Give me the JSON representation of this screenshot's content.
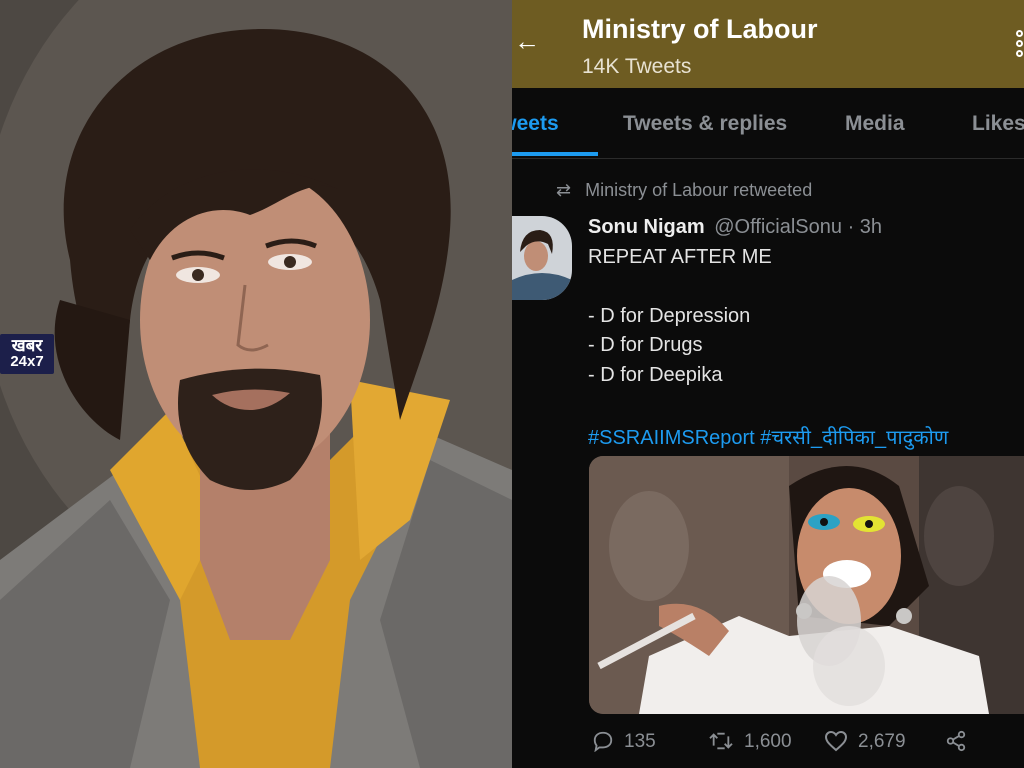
{
  "watermark": {
    "top": "खबर",
    "bottom": "24x7"
  },
  "profile": {
    "name": "Ministry of Labour",
    "tweet_count": "14K Tweets"
  },
  "tabs": [
    {
      "label": "Tweets",
      "active": true
    },
    {
      "label": "Tweets & replies",
      "active": false
    },
    {
      "label": "Media",
      "active": false
    },
    {
      "label": "Likes",
      "active": false
    }
  ],
  "tweet": {
    "retweet_label": "Ministry of Labour retweeted",
    "author_name": "Sonu Nigam",
    "author_handle": "@OfficialSonu",
    "time": "· 3h",
    "lines": [
      "REPEAT AFTER ME",
      "- D for Depression",
      "- D for Drugs",
      "- D for Deepika"
    ],
    "hashtags": "#SSRAIIMSReport #चरसी_दीपिका_पादुकोण",
    "replies": "135",
    "retweets": "1,600",
    "likes": "2,679"
  },
  "icons": {
    "back": "arrow-left-icon",
    "more": "more-vertical-icon",
    "retweet": "retweet-icon",
    "reply": "reply-icon",
    "like": "heart-icon",
    "share": "share-icon"
  },
  "colors": {
    "header": "#6e5c22",
    "accent": "#1d9bf0",
    "background": "#0b0b0b"
  }
}
